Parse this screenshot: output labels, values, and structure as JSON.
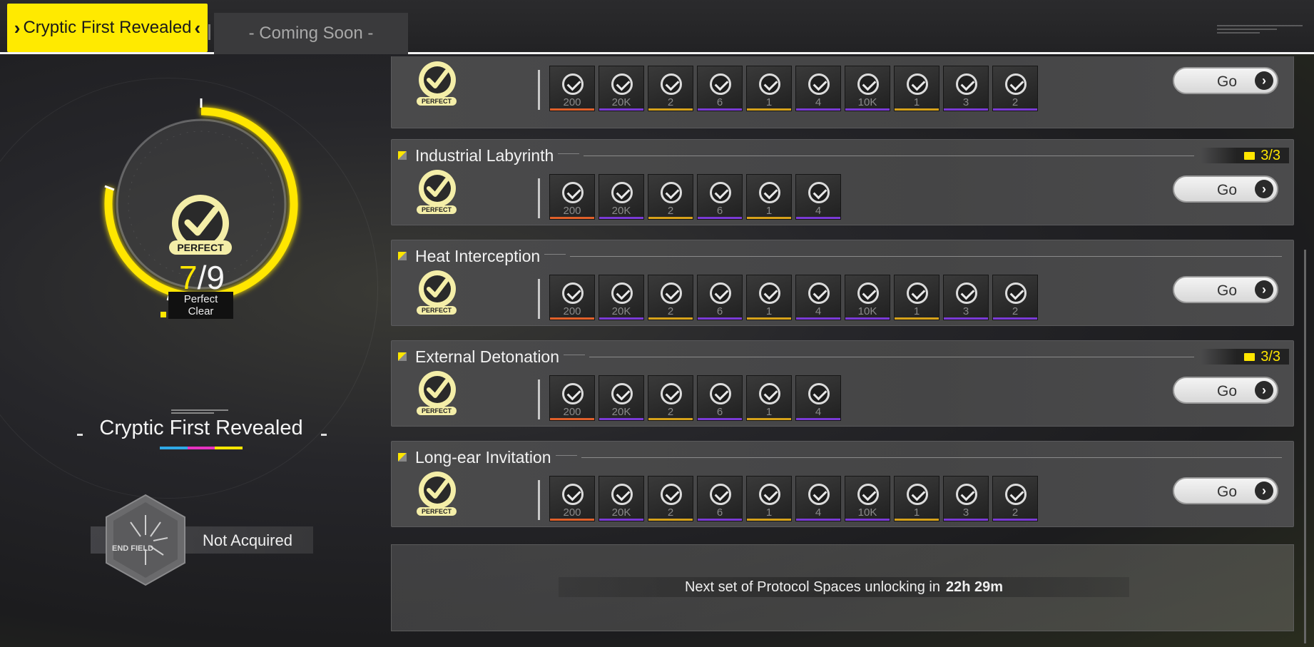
{
  "tabs": {
    "active": "Cryptic First Revealed",
    "inactive": "- Coming Soon -"
  },
  "left_panel": {
    "badge_label": "PERFECT",
    "score_num": "7",
    "score_slash": "/",
    "score_den": "9",
    "clear_line1": "Perfect",
    "clear_line2": "Clear",
    "collection_title": "Cryptic First Revealed",
    "color_bar": [
      "#2fa8e6",
      "#e632c0",
      "#ffe600"
    ],
    "medal_status": "Not Acquired",
    "medal_text": "END FIELD"
  },
  "accent_color": "#ffe600",
  "reward_sets": {
    "full": [
      {
        "qty": "200",
        "rar": "#e0602a"
      },
      {
        "qty": "20K",
        "rar": "#7a3ad6"
      },
      {
        "qty": "2",
        "rar": "#d6a21a"
      },
      {
        "qty": "6",
        "rar": "#7a3ad6"
      },
      {
        "qty": "1",
        "rar": "#d6a21a"
      },
      {
        "qty": "4",
        "rar": "#7a3ad6"
      },
      {
        "qty": "10K",
        "rar": "#7a3ad6"
      },
      {
        "qty": "1",
        "rar": "#d6a21a"
      },
      {
        "qty": "3",
        "rar": "#7a3ad6"
      },
      {
        "qty": "2",
        "rar": "#7a3ad6"
      }
    ]
  },
  "cards": [
    {
      "name": "",
      "progress": "",
      "badge_label": "PERFECT",
      "reward_count": 10,
      "go_label": "Go"
    },
    {
      "name": "Industrial Labyrinth",
      "progress": "3/3",
      "badge_label": "PERFECT",
      "reward_count": 6,
      "go_label": "Go"
    },
    {
      "name": "Heat Interception",
      "progress": "",
      "badge_label": "PERFECT",
      "reward_count": 10,
      "go_label": "Go"
    },
    {
      "name": "External Detonation",
      "progress": "3/3",
      "badge_label": "PERFECT",
      "reward_count": 6,
      "go_label": "Go"
    },
    {
      "name": "Long-ear Invitation",
      "progress": "",
      "badge_label": "PERFECT",
      "reward_count": 10,
      "go_label": "Go"
    }
  ],
  "unlock": {
    "text": "Next set of Protocol Spaces unlocking in",
    "time": "22h 29m"
  }
}
